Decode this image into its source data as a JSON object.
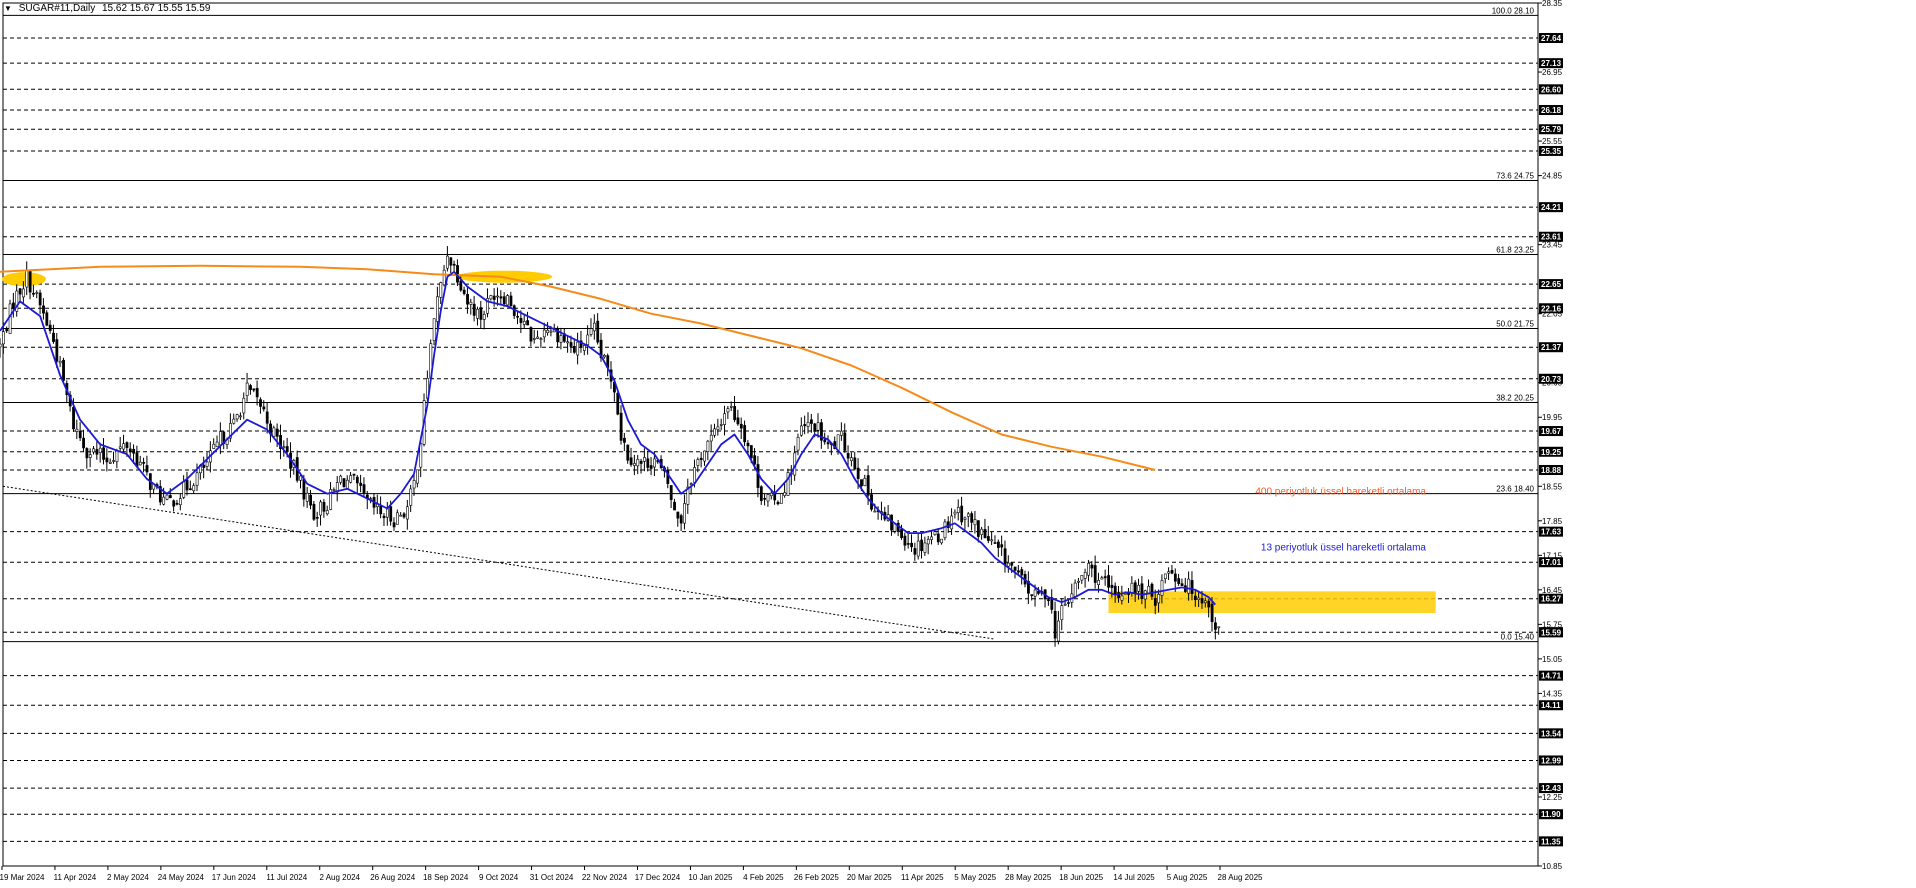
{
  "header": {
    "symbol_label": "SUGAR#11,Daily",
    "ohlc": "15.62 15.67 15.55 15.59",
    "menu_icon": "triangle-down-icon"
  },
  "annotations": {
    "ema400_label": "400 periyotluk üssel hareketli ortalama",
    "ema13_label": "13 periyotluk üssel hareketli ortalama"
  },
  "colors": {
    "background": "#ffffff",
    "candle": "#000000",
    "ema13": "#1a1ad6",
    "ema400": "#f58b1a",
    "highlight": "#ffcc00",
    "ema400_text": "#f05a28",
    "ema13_text": "#1a1ad6",
    "price_box": "#000000",
    "price_box_text": "#ffffff"
  },
  "chart_data": {
    "type": "candlestick",
    "title": "SUGAR#11,Daily",
    "ylim": [
      10.85,
      28.35
    ],
    "y_ticks": [
      "28.35",
      "26.95",
      "25.55",
      "24.85",
      "23.45",
      "22.05",
      "20.65",
      "19.95",
      "18.55",
      "17.85",
      "17.15",
      "16.45",
      "15.75",
      "15.05",
      "14.35",
      "12.25",
      "10.85"
    ],
    "price_levels": [
      27.64,
      27.13,
      26.6,
      26.18,
      25.79,
      25.35,
      24.21,
      23.61,
      22.65,
      22.16,
      21.37,
      20.73,
      19.67,
      19.25,
      18.88,
      17.63,
      17.01,
      16.27,
      15.59,
      14.71,
      14.11,
      13.54,
      12.99,
      12.43,
      11.9,
      11.35
    ],
    "fib_levels": [
      {
        "ratio": "100.0",
        "price": 28.1
      },
      {
        "ratio": "73.6",
        "price": 24.75
      },
      {
        "ratio": "61.8",
        "price": 23.25
      },
      {
        "ratio": "50.0",
        "price": 21.75
      },
      {
        "ratio": "38.2",
        "price": 20.25
      },
      {
        "ratio": "23.6",
        "price": 18.4
      },
      {
        "ratio": "0.0",
        "price": 15.4
      }
    ],
    "current_price": 15.59,
    "x_dates": [
      "19 Mar 2024",
      "11 Apr 2024",
      "2 May 2024",
      "24 May 2024",
      "17 Jun 2024",
      "11 Jul 2024",
      "2 Aug 2024",
      "26 Aug 2024",
      "18 Sep 2024",
      "9 Oct 2024",
      "31 Oct 2024",
      "22 Nov 2024",
      "17 Dec 2024",
      "10 Jan 2025",
      "4 Feb 2025",
      "26 Feb 2025",
      "20 Mar 2025",
      "11 Apr 2025",
      "5 May 2025",
      "28 May 2025",
      "18 Jun 2025",
      "14 Jul 2025",
      "5 Aug 2025",
      "28 Aug 2025"
    ],
    "close_path": [
      [
        0,
        21.4
      ],
      [
        4,
        22.3
      ],
      [
        8,
        22.8
      ],
      [
        12,
        22.2
      ],
      [
        16,
        21.5
      ],
      [
        22,
        19.8
      ],
      [
        26,
        19.3
      ],
      [
        32,
        19.1
      ],
      [
        38,
        19.4
      ],
      [
        42,
        19.0
      ],
      [
        46,
        18.5
      ],
      [
        50,
        18.2
      ],
      [
        54,
        18.4
      ],
      [
        58,
        18.7
      ],
      [
        62,
        19.0
      ],
      [
        66,
        19.5
      ],
      [
        70,
        19.8
      ],
      [
        74,
        20.5
      ],
      [
        78,
        20.2
      ],
      [
        82,
        19.6
      ],
      [
        86,
        19.2
      ],
      [
        90,
        18.6
      ],
      [
        94,
        18.0
      ],
      [
        98,
        18.2
      ],
      [
        102,
        18.7
      ],
      [
        106,
        18.6
      ],
      [
        110,
        18.2
      ],
      [
        114,
        18.0
      ],
      [
        118,
        17.9
      ],
      [
        122,
        18.1
      ],
      [
        124,
        18.6
      ],
      [
        126,
        19.5
      ],
      [
        128,
        20.8
      ],
      [
        130,
        22.0
      ],
      [
        132,
        22.6
      ],
      [
        134,
        23.3
      ],
      [
        136,
        23.0
      ],
      [
        138,
        22.7
      ],
      [
        140,
        22.3
      ],
      [
        144,
        22.0
      ],
      [
        148,
        22.5
      ],
      [
        152,
        22.4
      ],
      [
        156,
        21.9
      ],
      [
        160,
        21.5
      ],
      [
        164,
        21.8
      ],
      [
        168,
        21.6
      ],
      [
        172,
        21.3
      ],
      [
        176,
        21.5
      ],
      [
        178,
        21.7
      ],
      [
        180,
        21.2
      ],
      [
        184,
        20.6
      ],
      [
        186,
        19.6
      ],
      [
        188,
        19.2
      ],
      [
        192,
        19.0
      ],
      [
        196,
        19.1
      ],
      [
        200,
        18.6
      ],
      [
        202,
        18.0
      ],
      [
        204,
        17.9
      ],
      [
        206,
        18.6
      ],
      [
        210,
        19.2
      ],
      [
        214,
        19.6
      ],
      [
        218,
        20.2
      ],
      [
        222,
        19.8
      ],
      [
        224,
        19.4
      ],
      [
        228,
        18.4
      ],
      [
        232,
        18.2
      ],
      [
        236,
        18.7
      ],
      [
        240,
        19.7
      ],
      [
        244,
        19.8
      ],
      [
        248,
        19.3
      ],
      [
        252,
        19.5
      ],
      [
        256,
        19.0
      ],
      [
        258,
        18.7
      ],
      [
        262,
        18.1
      ],
      [
        266,
        17.8
      ],
      [
        270,
        17.6
      ],
      [
        274,
        17.3
      ],
      [
        278,
        17.5
      ],
      [
        282,
        17.6
      ],
      [
        286,
        18.1
      ],
      [
        290,
        17.9
      ],
      [
        294,
        17.6
      ],
      [
        298,
        17.3
      ],
      [
        302,
        17.0
      ],
      [
        306,
        16.6
      ],
      [
        310,
        16.3
      ],
      [
        314,
        16.4
      ],
      [
        316,
        15.6
      ],
      [
        318,
        16.0
      ],
      [
        322,
        16.5
      ],
      [
        326,
        16.9
      ],
      [
        330,
        16.6
      ],
      [
        334,
        16.3
      ],
      [
        338,
        16.5
      ],
      [
        342,
        16.4
      ],
      [
        346,
        16.3
      ],
      [
        350,
        16.9
      ],
      [
        354,
        16.6
      ],
      [
        358,
        16.4
      ],
      [
        360,
        16.3
      ],
      [
        362,
        16.1
      ],
      [
        364,
        15.75
      ],
      [
        365,
        15.59
      ]
    ],
    "ema13_path": [
      [
        0,
        21.7
      ],
      [
        6,
        22.3
      ],
      [
        12,
        22.0
      ],
      [
        18,
        20.8
      ],
      [
        24,
        19.9
      ],
      [
        30,
        19.4
      ],
      [
        38,
        19.2
      ],
      [
        44,
        18.7
      ],
      [
        50,
        18.4
      ],
      [
        56,
        18.7
      ],
      [
        62,
        19.1
      ],
      [
        68,
        19.5
      ],
      [
        74,
        19.9
      ],
      [
        80,
        19.7
      ],
      [
        86,
        19.2
      ],
      [
        92,
        18.6
      ],
      [
        98,
        18.4
      ],
      [
        104,
        18.5
      ],
      [
        110,
        18.3
      ],
      [
        116,
        18.1
      ],
      [
        120,
        18.4
      ],
      [
        124,
        18.8
      ],
      [
        126,
        19.5
      ],
      [
        128,
        20.2
      ],
      [
        130,
        21.2
      ],
      [
        132,
        22.1
      ],
      [
        134,
        22.8
      ],
      [
        136,
        22.9
      ],
      [
        140,
        22.6
      ],
      [
        146,
        22.3
      ],
      [
        152,
        22.2
      ],
      [
        158,
        22.0
      ],
      [
        164,
        21.8
      ],
      [
        170,
        21.6
      ],
      [
        176,
        21.4
      ],
      [
        180,
        21.2
      ],
      [
        184,
        20.7
      ],
      [
        188,
        19.9
      ],
      [
        192,
        19.4
      ],
      [
        196,
        19.2
      ],
      [
        200,
        18.8
      ],
      [
        204,
        18.4
      ],
      [
        208,
        18.6
      ],
      [
        212,
        19.0
      ],
      [
        216,
        19.4
      ],
      [
        220,
        19.6
      ],
      [
        224,
        19.2
      ],
      [
        228,
        18.7
      ],
      [
        232,
        18.4
      ],
      [
        236,
        18.7
      ],
      [
        240,
        19.2
      ],
      [
        244,
        19.6
      ],
      [
        248,
        19.5
      ],
      [
        252,
        19.2
      ],
      [
        256,
        18.7
      ],
      [
        260,
        18.3
      ],
      [
        264,
        18.0
      ],
      [
        268,
        17.8
      ],
      [
        272,
        17.6
      ],
      [
        276,
        17.6
      ],
      [
        282,
        17.7
      ],
      [
        286,
        17.8
      ],
      [
        290,
        17.6
      ],
      [
        294,
        17.4
      ],
      [
        298,
        17.1
      ],
      [
        302,
        16.9
      ],
      [
        306,
        16.7
      ],
      [
        310,
        16.5
      ],
      [
        314,
        16.3
      ],
      [
        318,
        16.2
      ],
      [
        322,
        16.3
      ],
      [
        326,
        16.45
      ],
      [
        330,
        16.45
      ],
      [
        334,
        16.35
      ],
      [
        338,
        16.4
      ],
      [
        342,
        16.35
      ],
      [
        346,
        16.4
      ],
      [
        350,
        16.45
      ],
      [
        354,
        16.5
      ],
      [
        358,
        16.45
      ],
      [
        362,
        16.3
      ],
      [
        364,
        16.15
      ]
    ],
    "ema400_path": [
      [
        0,
        22.9
      ],
      [
        30,
        23.0
      ],
      [
        60,
        23.02
      ],
      [
        90,
        23.0
      ],
      [
        110,
        22.95
      ],
      [
        130,
        22.85
      ],
      [
        150,
        22.8
      ],
      [
        165,
        22.6
      ],
      [
        180,
        22.35
      ],
      [
        195,
        22.05
      ],
      [
        210,
        21.85
      ],
      [
        225,
        21.6
      ],
      [
        240,
        21.35
      ],
      [
        255,
        21.0
      ],
      [
        270,
        20.55
      ],
      [
        285,
        20.05
      ],
      [
        300,
        19.6
      ],
      [
        315,
        19.35
      ],
      [
        330,
        19.15
      ],
      [
        346,
        18.88
      ]
    ]
  }
}
